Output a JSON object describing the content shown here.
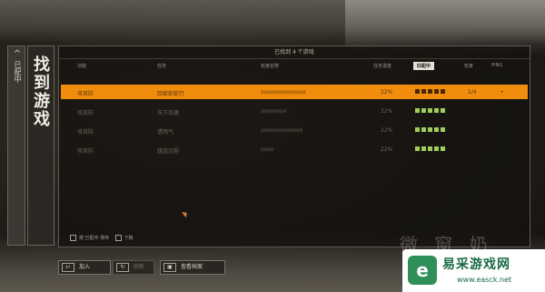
{
  "side_tab": {
    "label": "已配中"
  },
  "title": "找到游戏",
  "panel": {
    "header": "已找到 4 个游戏",
    "columns": [
      "功能",
      "任务",
      "玩家名称",
      "任务进度",
      "匹配中",
      "玩家",
      "PING"
    ]
  },
  "rows": [
    {
      "col1": "攻其防",
      "col2": "回家蛇蛇行",
      "col3": "xxxxxxxxxxxxxx",
      "progress": "22%",
      "rating": 5,
      "players": "1/4",
      "ping": "•"
    },
    {
      "col1": "攻其防",
      "col2": "东方加速",
      "col3": "xxxxxxxx",
      "progress": "22%",
      "rating": 5,
      "players": "",
      "ping": ""
    },
    {
      "col1": "攻其防",
      "col2": "透明气",
      "col3": "xxxxxxxxxxxxx",
      "progress": "22%",
      "rating": 5,
      "players": "",
      "ping": ""
    },
    {
      "col1": "攻其防",
      "col2": "越道远程",
      "col3": "xxxx",
      "progress": "22%",
      "rating": 5,
      "players": "",
      "ping": ""
    }
  ],
  "legend": {
    "item1": "按 已配中 排序",
    "item2": "下跑"
  },
  "buttons": {
    "join": "加入",
    "middle": "刷新",
    "profile": "查看档案"
  },
  "watermark": {
    "name": "易采游戏网",
    "url": "www.easck.net",
    "faint": "微 窗 奶"
  },
  "colors": {
    "selected_row": "#f08d0d",
    "star": "#9fcf5a"
  }
}
